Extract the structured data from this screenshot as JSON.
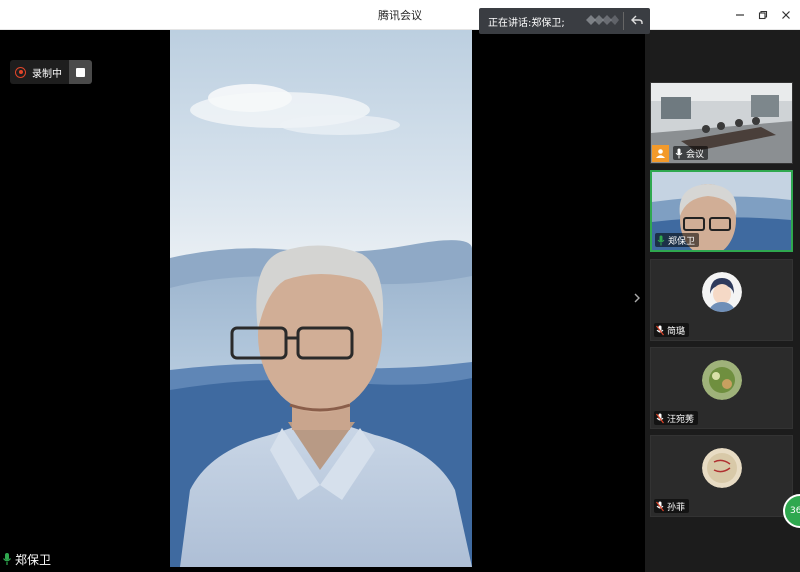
{
  "window": {
    "title": "腾讯会议"
  },
  "speaking": {
    "prefix": "正在讲话:",
    "name": "郑保卫;"
  },
  "recording": {
    "label": "录制中"
  },
  "main_video": {
    "speaker_name": "郑保卫"
  },
  "gallery": {
    "tiles": [
      {
        "name": "会议",
        "type": "video-room",
        "host": true
      },
      {
        "name": "郑保卫",
        "type": "video-person",
        "active": true
      },
      {
        "name": "简璐",
        "type": "avatar"
      },
      {
        "name": "汪宛莠",
        "type": "avatar"
      },
      {
        "name": "孙菲",
        "type": "avatar"
      }
    ]
  },
  "floating": {
    "label": "36"
  },
  "colors": {
    "accent_green": "#2fa84f",
    "record_red": "#e0452a",
    "host_orange": "#f39a2b"
  },
  "icons": [
    "minimize-icon",
    "maximize-icon",
    "close-icon",
    "record-icon",
    "stop-icon",
    "mic-icon",
    "host-icon",
    "chevron-right-icon",
    "back-icon"
  ]
}
